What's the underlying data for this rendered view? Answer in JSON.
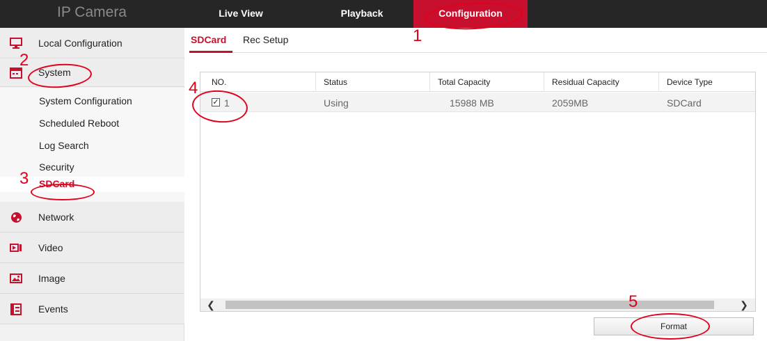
{
  "header": {
    "brand": "IP Camera",
    "nav": {
      "live_view": "Live View",
      "playback": "Playback",
      "configuration": "Configuration"
    }
  },
  "sidebar": {
    "local_configuration": "Local Configuration",
    "system": "System",
    "system_sub": {
      "system_configuration": "System Configuration",
      "scheduled_reboot": "Scheduled Reboot",
      "log_search": "Log Search",
      "security": "Security",
      "sdcard": "SDCard"
    },
    "network": "Network",
    "video": "Video",
    "image": "Image",
    "events": "Events"
  },
  "tabs": {
    "sdcard": "SDCard",
    "rec_setup": "Rec Setup"
  },
  "table": {
    "columns": [
      "NO.",
      "Status",
      "Total Capacity",
      "Residual Capacity",
      "Device Type"
    ],
    "rows": [
      {
        "no": "1",
        "status": "Using",
        "total": "15988 MB",
        "residual": "2059MB",
        "type": "SDCard",
        "checked": true
      }
    ]
  },
  "scroll": {
    "left": "❮",
    "right": "❯"
  },
  "actions": {
    "format": "Format"
  },
  "annotations": [
    "1",
    "2",
    "3",
    "4",
    "5"
  ],
  "colors": {
    "accent": "#c8102e",
    "annotation": "#e3001b",
    "topbar": "#262626"
  }
}
